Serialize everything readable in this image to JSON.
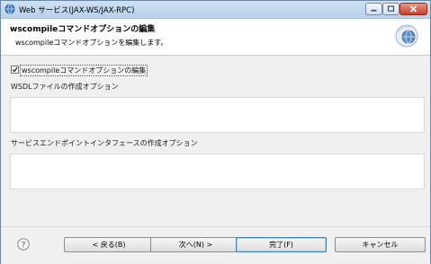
{
  "window": {
    "title": "Web サービス(JAX-WS/JAX-RPC)"
  },
  "header": {
    "title": "wscompileコマンドオプションの編集",
    "description": "wscompileコマンドオプションを編集します。"
  },
  "content": {
    "edit_checkbox": {
      "label": "wscompileコマンドオプションの編集",
      "checked": true
    },
    "wsdl_section_label": "WSDLファイルの作成オプション",
    "wsdl_value": "",
    "sei_section_label": "サービスエンドポイントインタフェースの作成オプション",
    "sei_value": ""
  },
  "footer": {
    "back_label": "< 戻る(B)",
    "next_label": "次へ(N) >",
    "finish_label": "完了(F)",
    "cancel_label": "キャンセル"
  },
  "colors": {
    "titlebar": "#b9d1ea",
    "close_button": "#c7402a",
    "default_button_border": "#3c7fb1"
  },
  "icons": {
    "app": "web-service-icon",
    "header": "wizard-globe-icon",
    "help": "help-icon"
  }
}
